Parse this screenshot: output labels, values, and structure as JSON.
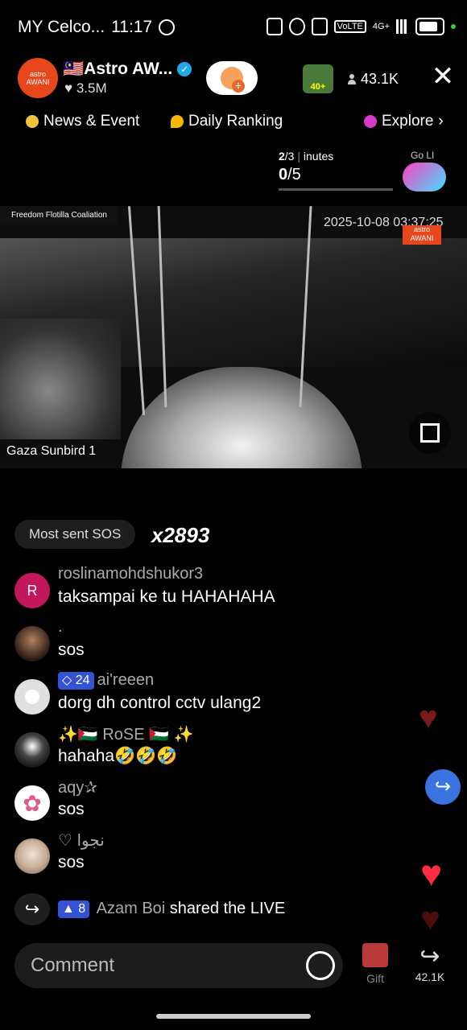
{
  "status_bar": {
    "carrier": "MY Celco...",
    "time": "11:17",
    "network": "4G+"
  },
  "host": {
    "name": "🇲🇾Astro AW...",
    "likes": "3.5M",
    "avatar_text_top": "astro",
    "avatar_text_bottom": "AWANI"
  },
  "viewer_badge": "40+",
  "viewers": "43.1K",
  "tabs": [
    {
      "label": "News & Event",
      "color": "#f2c23a"
    },
    {
      "label": "Daily Ranking",
      "color": "#f5b800"
    },
    {
      "label": "Explore",
      "color": "#d639c8"
    }
  ],
  "progress": {
    "top_a": "2",
    "top_b": "/3",
    "top_c": "inutes",
    "main_a": "0",
    "main_b": "/5"
  },
  "golive_label": "Go LI",
  "video": {
    "source_tag": "Freedom Flotilla Coaliation",
    "timestamp": "2025-10-08 03:37:25",
    "logo_top": "astro",
    "logo_bottom": "AWANI",
    "caption": "Gaza Sunbird 1"
  },
  "most_sent": {
    "label": "Most sent SOS",
    "count": "x2893"
  },
  "comments": [
    {
      "user": "roslinamohdshukor3",
      "text": "taksampai ke tu HAHAHAHA",
      "avatar": "R",
      "avatar_color": "#c2185b"
    },
    {
      "user": ".",
      "text": "sos",
      "avatar": "",
      "avatar_color": "#3a2a22"
    },
    {
      "level": "24",
      "user": "ai'reeen",
      "text": "dorg dh control cctv ulang2",
      "avatar": "",
      "avatar_color": "#e0e0e0"
    },
    {
      "user": "✨🇵🇸 RoSE 🇵🇸 ✨",
      "text": "hahaha🤣🤣🤣",
      "avatar": "",
      "avatar_color": "#555"
    },
    {
      "user": "aqy✰",
      "text": "sos",
      "avatar": "✿",
      "avatar_color": "#fff"
    },
    {
      "user": "♡ نجوا",
      "text": "sos",
      "avatar": "",
      "avatar_color": "#d9c7b8"
    }
  ],
  "shared": {
    "level": "8",
    "user": "Azam Boi",
    "action": "shared the LIVE"
  },
  "bottom": {
    "comment_placeholder": "Comment",
    "gift_label": "Gift",
    "share_count": "42.1K"
  }
}
